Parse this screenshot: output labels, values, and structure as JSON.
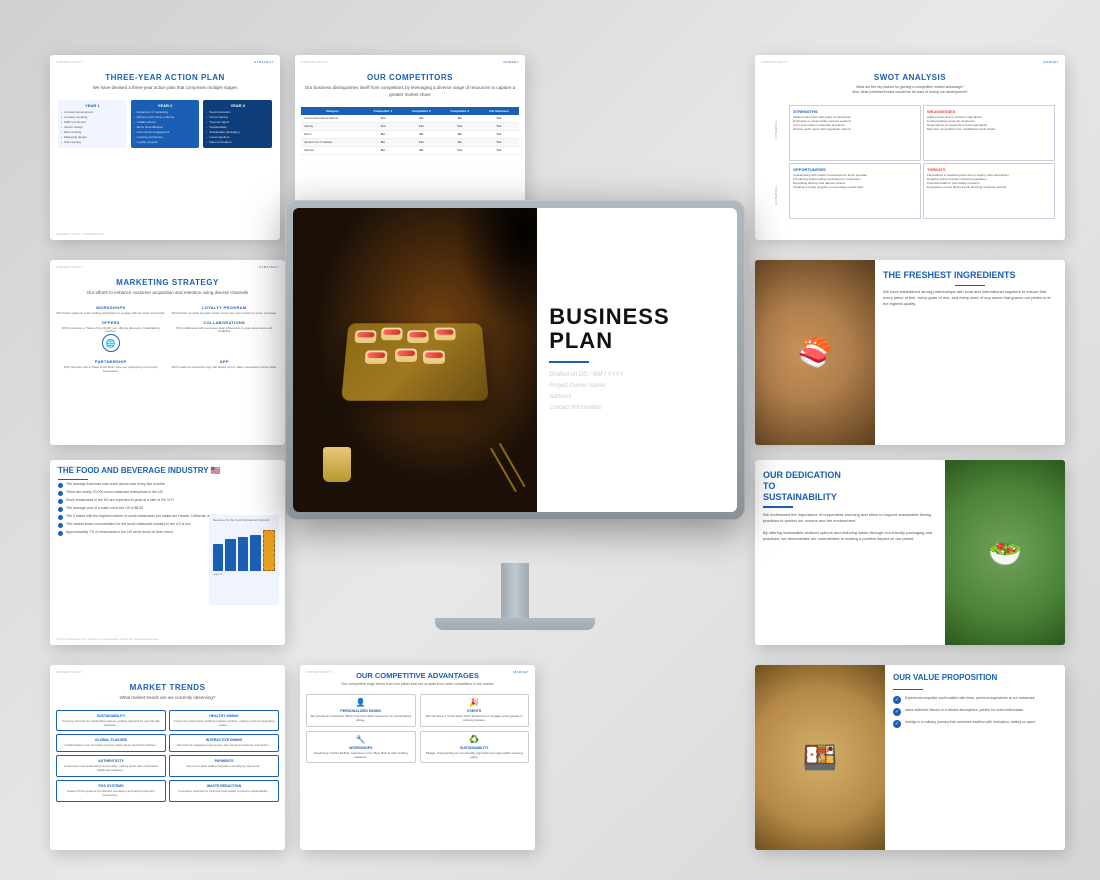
{
  "scene": {
    "background": "#e0e0e0"
  },
  "slides": {
    "action_plan": {
      "label": "OPPORTUNITY",
      "label_right": "STRATEGY",
      "title": "THREE-YEAR ACTION PLAN",
      "subtitle": "We have devised a three-year action plan that comprises multiple stages",
      "years": [
        {
          "label": "YEAR 1",
          "items": [
            "Concept development and menu curation",
            "Location scouting and lease negotiation",
            "Staff recruitment and training initiatives",
            "Interior design and construction commencement",
            "Menu testing and refinement",
            "Marketing material design and branding",
            "Soft opening to gather feedback"
          ]
        },
        {
          "label": "YEAR 2",
          "items": [
            "Expansion of marketing efforts",
            "Introduction of delivery and online ordering",
            "Collaborations with local food businesses",
            "Menu diversification based on customer feedback",
            "Community engagement and partnerships",
            "Host cooking workshops",
            "Introduction of loyalty program"
          ]
        },
        {
          "label": "YEAR 3",
          "items": [
            "Second location scouting and preparation",
            "Optimize smooth cross-training",
            "Finances: themed nights",
            "Sustainability initiatives",
            "Introducing sustainable packaging",
            "Strengthen ties with local suppliers and farms",
            "Menu innovation and seasonal offerings"
          ]
        }
      ],
      "footer_left": "BUSINESS PLAN - CONFIDENTIAL",
      "footer_right": ""
    },
    "competitors": {
      "label": "OPPORTUNITY",
      "label_right": "MARKET",
      "title": "OUR COMPETITORS",
      "subtitle": "Our business distinguishes itself from competitors by leveraging a diverse range of resources to capture a greater market share",
      "columns": [
        "Category",
        "Competitor 1",
        "Competitor 2",
        "Competitor 3",
        "Our Business"
      ],
      "rows": [
        {
          "category": "Last-minute Reservations",
          "c1": "Yes",
          "c2": "No",
          "c3": "No",
          "us": "Yes"
        },
        {
          "category": "Variety",
          "c1": "Yes",
          "c2": "Yes",
          "c3": "Yes",
          "us": "Yes"
        },
        {
          "category": "Menu",
          "c1": "No",
          "c2": "No",
          "c3": "No",
          "us": "Yes"
        },
        {
          "category": "Options for Omakase",
          "c1": "No",
          "c2": "Yes",
          "c3": "No",
          "us": "Yes"
        },
        {
          "category": "Sauces",
          "c1": "No",
          "c2": "No",
          "c3": "Yes",
          "us": "Yes"
        }
      ]
    },
    "swot": {
      "label": "OPPORTUNITY",
      "label_right": "MARKET",
      "title": "SWOT ANALYSIS",
      "question": "What are the key factors for gaining a competitive market advantage?",
      "question2": "Also, what potential threats should we be wary of during our development?",
      "cells": [
        {
          "key": "STRENGTHS",
          "text": "Skilled sushi chefs with years of experience\nEmphasis on using locally sourced seafood\nCozy and modern restaurant ambiance\nDiverse sushi menu with vegetarian options"
        },
        {
          "key": "WEAKNESSES",
          "text": "Higher prices due to premium ingredients\nLimited seating space for customers\nDependence on seasonal or local ingredients\nMay face competition from established sushi chains"
        },
        {
          "key": "OPPORTUNITIES",
          "text": "Collaborating with nearby businesses for lunch specials\nIntroducing sushi-making workshops for customers\nExpanding delivery and takeout options\nCreating a loyalty program to encourage repeat visits"
        },
        {
          "key": "THREATS",
          "text": "Fluctuations in seafood prices due to supply chain disruptions\nNegative online reviews impacting reputation\nPotential health or food safety concerns\nEmergence of new dining trends diverting customer interest"
        }
      ],
      "side_labels": [
        "INTERNAL",
        "EXTERNAL"
      ]
    },
    "marketing": {
      "label": "OPPORTUNITY",
      "label_right": "STRATEGY",
      "title": "MARKETING STRATEGY",
      "subtitle": "Our efforts to enhance customer acquisition and retention using diverse channels",
      "items": [
        {
          "key": "WORKSHOPS",
          "text": "WOI hosts quarterly sushi-making workshops to engage with our local community."
        },
        {
          "key": "OFFERS",
          "text": "WOI introduces a 'Taste of the Month' set, offering discounts, breathtaking combos."
        },
        {
          "key": "PARTNERSHIP",
          "text": "WOI partners with a 'Taste of the Best' wine set, supporting community businesses."
        },
        {
          "key": "LOYALTY PROGRAM",
          "text": "WOI launch a loyalty program where customers earn points for every purchase to redeem at a delicious restaurant experience."
        },
        {
          "key": "COLLABORATIONS",
          "text": "WOI collaborate will renowned local influencers to raise awareness, boost foot traffic and credibility."
        },
        {
          "key": "APP",
          "text": "WOI create an interactive app that that allows you to make reservations at the table."
        }
      ]
    },
    "freshest": {
      "title": "THE FRESHEST INGREDIENTS",
      "text": "We have established strong partnerships with local and international suppliers to ensure that every piece of fish, every grain of rice, and every dash of soy sauce that graces our plates is of the highest quality.",
      "image_alt": "sushi rolls image"
    },
    "business_plan": {
      "title": "BUSINESS",
      "title2": "PLAN",
      "line1": "Drafted on DD / MM / YYYY",
      "line2": "Project Owner Name",
      "line3": "Address",
      "line4": "Contact Information"
    },
    "food_beverage": {
      "label": "OPPORTUNITY",
      "title": "THE FOOD AND BEVERAGE INDUSTRY 🇺🇸",
      "items": [
        "The average American eats sushi about once every two months",
        "There are nearly 20,000 sushi restaurant enterprises in the US",
        "Sushi restaurants in the US are expected to grow at a rate of 2% YOY",
        "The average cost of a sushi roll in the US is $8.50",
        "The 3 states with the highest number of sushi restaurants per capita are Hawaii, California, and New York",
        "The market share concentration for the sushi restaurant industry in the US is low, which means the top four companies generate less than 40% of industry revenue",
        "Approximately 7% of restaurants in the US serve sushi on their menu"
      ],
      "chart_label": "Revenue for the Sushi Restaurant Industry, reaching ...",
      "target_label": "target of ..."
    },
    "sustainability": {
      "title": "OUR DEDICATION TO SUSTAINABILITY",
      "text1": "We understand the importance of responsible sourcing and strive to support sustainable fishing practices to protect our oceans and the environment.",
      "text2": "By offering sustainable seafood options and reducing waste through eco-friendly packaging and practices, we demonstrate our commitment to making a positive impact on our planet.",
      "image_alt": "spring rolls image"
    },
    "market_trends": {
      "label": "OPPORTUNITY",
      "title": "MARKET TRENDS",
      "question": "What market trends are we currently observing?",
      "trends": [
        {
          "key": "SUSTAINABILITY",
          "text": "Growing demand for sustainable options, guiding demand for eco-friendly practices in the restaurant..."
        },
        {
          "key": "HEALTHY DINING",
          "text": "Consumer preferences shifting towards nutrition, making sushi an appealing option..."
        },
        {
          "key": "GLOBAL FLAVORS",
          "text": "Collaborations and innovative diverse fusion ideas and fusion dishes from different cuisines..."
        },
        {
          "key": "INTERACTIVE DINING",
          "text": "Demand for engaging experiences, like the top-level customer interaction at the table..."
        },
        {
          "key": "AUTHENTICITY",
          "text": "Customers seek authenticity and quality, making sushi bars that emphasize traditional practices and ingredients..."
        },
        {
          "key": "PAYMENTS",
          "text": "App and mobile wallet integration simplifying payments and ensure smooth payment system..."
        },
        {
          "key": "POS SYSTEMS",
          "text": "Modern POS systems for efficient operations and secure payment processing and inventory management..."
        },
        {
          "key": "WASTE REDUCTION",
          "text": "Innovative solutions to minimize food waste to ensure sustainability and composting..."
        }
      ]
    },
    "competitive_advantages": {
      "label": "OPPORTUNITY",
      "label_right": "MARKET",
      "title": "OUR COMPETITIVE ADVANTAGES",
      "subtitle": "Our competitive edge stems from four pillars that set us apart from other competitors in the market",
      "pillars": [
        {
          "key": "PERSONALIZED DINING",
          "icon": "👤",
          "text": "We provide an interactive 'Build-Your-Own-Roll' experience for personalized dining."
        },
        {
          "key": "EVENTS",
          "icon": "🎉",
          "text": "We introduce a 'Yoshi Sushi Chef' Experience to engage young guests in the culinary process."
        },
        {
          "key": "WORKSHOPS",
          "icon": "🔧",
          "text": "Introducing 'Yoshi's Rolling' customers to... That 'Best Roll' at calm crafting."
        },
        {
          "key": "SUSTAINABILITY",
          "icon": "♻️",
          "text": "Pledge: championing our eco-friendly approach and responsible sourcing policy."
        }
      ]
    },
    "value_proposition": {
      "title": "OUR VALUE PROPOSITION",
      "items": [
        "Experience exquisite sushi crafted with fresh, premium ingredients at our restaurant.",
        "savor authentic flavors in a vibrant atmosphere, perfect for sushi enthusiasts.",
        "Indulge in a culinary journey that combines tradition with innovation, setting us apart."
      ],
      "image_alt": "sushi platter image"
    }
  }
}
